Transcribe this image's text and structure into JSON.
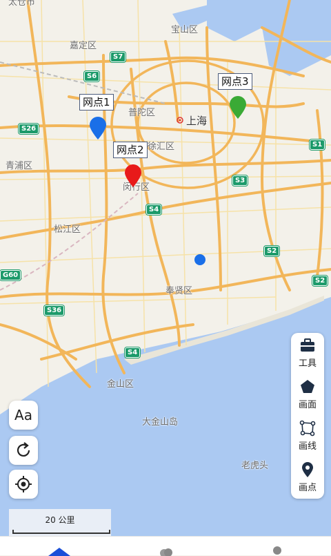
{
  "map": {
    "places": {
      "baoshan": "宝山区",
      "jiading": "嘉定区",
      "putuo": "普陀区",
      "shanghai": "上海",
      "xuhui": "徐汇区",
      "qingpu": "青浦区",
      "minhang": "闵行区",
      "songjiang": "松江区",
      "fengxian": "奉贤区",
      "jinshan": "金山区",
      "dajinshan": "大金山岛",
      "laohutou": "老虎头",
      "taicang": "太仓市"
    },
    "shields": [
      "S7",
      "S6",
      "S26",
      "S1",
      "S3",
      "S4",
      "G60",
      "S2",
      "S2",
      "S36",
      "S4"
    ],
    "markers": [
      {
        "label": "网点1",
        "color": "#1a6fe8"
      },
      {
        "label": "网点2",
        "color": "#e81a1a"
      },
      {
        "label": "网点3",
        "color": "#3aaa35"
      }
    ],
    "location_dot_color": "#1a6fe8"
  },
  "controls": {
    "font_size_label": "Aa"
  },
  "toolbar": {
    "items": [
      {
        "label": "工具",
        "icon": "toolbox-icon"
      },
      {
        "label": "画面",
        "icon": "pentagon-icon"
      },
      {
        "label": "画线",
        "icon": "polyline-icon"
      },
      {
        "label": "画点",
        "icon": "point-icon"
      }
    ]
  },
  "scale": {
    "label": "20 公里"
  }
}
